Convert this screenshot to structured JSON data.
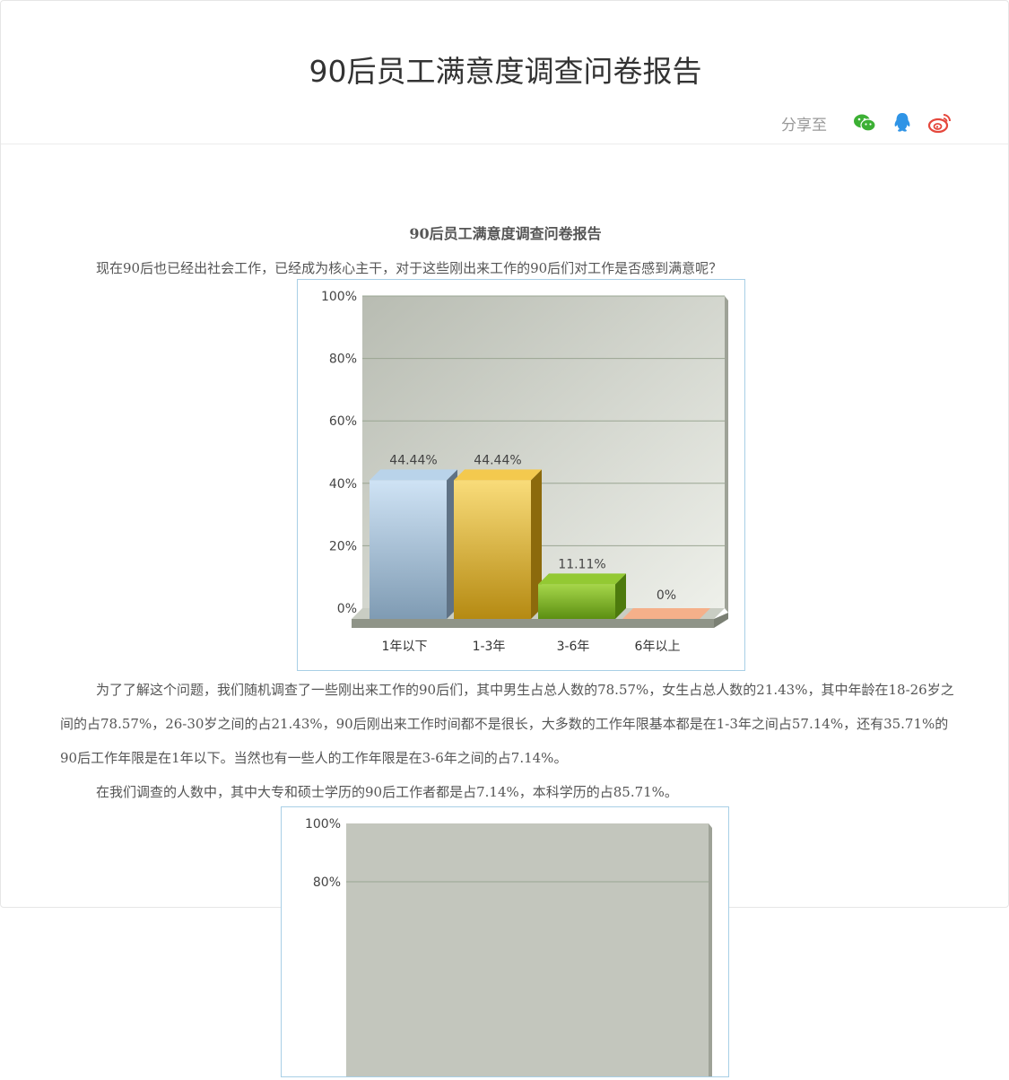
{
  "header": {
    "title": "90后员工满意度调查问卷报告",
    "share_label": "分享至",
    "share_icons": [
      "wechat-icon",
      "qq-icon",
      "weibo-icon"
    ]
  },
  "article": {
    "title": "90后员工满意度调查问卷报告",
    "para1": "现在90后也已经出社会工作，已经成为核心主干，对于这些刚出来工作的90后们对工作是否感到满意呢？",
    "para2": "为了了解这个问题，我们随机调查了一些刚出来工作的90后们，其中男生占总人数的78.57%，女生占总人数的21.43%，其中年龄在18-26岁之间的占78.57%，26-30岁之间的占21.43%，90后刚出来工作时间都不是很长，大多数的工作年限基本都是在1-3年之间占57.14%，还有35.71%的90后工作年限是在1年以下。当然也有一些人的工作年限是在3-6年之间的占7.14%。",
    "para3": "在我们调查的人数中，其中大专和硕士学历的90后工作者都是占7.14%，本科学历的占85.71%。"
  },
  "chart_data": [
    {
      "type": "bar",
      "categories": [
        "1年以下",
        "1-3年",
        "3-6年",
        "6年以上"
      ],
      "values": [
        44.44,
        44.44,
        11.11,
        0
      ],
      "data_labels": [
        "44.44%",
        "44.44%",
        "11.11%",
        "0%"
      ],
      "ylim": [
        0,
        100
      ],
      "yticks": [
        "0%",
        "20%",
        "40%",
        "60%",
        "80%",
        "100%"
      ],
      "colors": [
        "#a9c3dc",
        "#e3b53a",
        "#7eb52a",
        "#f08a5b"
      ],
      "grid": true
    },
    {
      "type": "bar",
      "yticks": [
        "80%",
        "100%"
      ],
      "ylim": [
        0,
        100
      ]
    }
  ]
}
